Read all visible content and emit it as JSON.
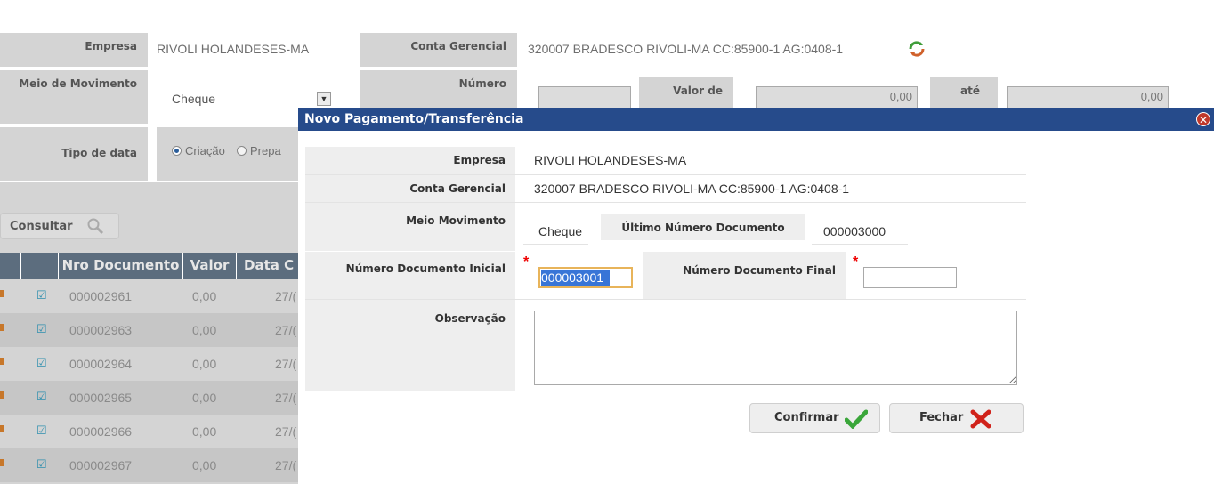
{
  "filters": {
    "empresa_label": "Empresa",
    "empresa_value": "RIVOLI HOLANDESES-MA",
    "conta_label": "Conta Gerencial",
    "conta_value": "320007  BRADESCO RIVOLI-MA CC:85900-1 AG:0408-1",
    "meio_label": "Meio de Movimento",
    "meio_value": "Cheque",
    "numero_label": "Número",
    "valor_de_label": "Valor de",
    "valor_de_value": "0,00",
    "ate_label": "até",
    "ate_value": "0,00",
    "tipo_data_label": "Tipo de data",
    "tipo_data_option1": "Criação",
    "tipo_data_option2": "Prepa"
  },
  "consultar_label": "Consultar",
  "grid": {
    "headers": [
      "Nro Documento",
      "Valor",
      "Data C"
    ],
    "rows": [
      {
        "doc": "000002961",
        "valor": "0,00",
        "data": "27/("
      },
      {
        "doc": "000002963",
        "valor": "0,00",
        "data": "27/("
      },
      {
        "doc": "000002964",
        "valor": "0,00",
        "data": "27/("
      },
      {
        "doc": "000002965",
        "valor": "0,00",
        "data": "27/("
      },
      {
        "doc": "000002966",
        "valor": "0,00",
        "data": "27/("
      },
      {
        "doc": "000002967",
        "valor": "0,00",
        "data": "27/("
      }
    ]
  },
  "dialog": {
    "title": "Novo Pagamento/Transferência",
    "empresa_label": "Empresa",
    "empresa_value": "RIVOLI HOLANDESES-MA",
    "conta_label": "Conta Gerencial",
    "conta_value": "320007  BRADESCO RIVOLI-MA CC:85900-1 AG:0408-1",
    "meio_label": "Meio Movimento",
    "meio_value": "Cheque",
    "ultimo_label": "Último Número Documento",
    "ultimo_value": "000003000",
    "inicial_label": "Número Documento Inicial",
    "inicial_value": "000003001",
    "final_label": "Número Documento Final",
    "final_value": "",
    "observacao_label": "Observação",
    "observacao_value": "",
    "confirmar_label": "Confirmar",
    "fechar_label": "Fechar"
  },
  "colors": {
    "title_bar": "#264b8b",
    "grid_header": "#5c6d7e",
    "required": "#ee0000"
  },
  "icons": [
    "refresh-icon",
    "dropdown-arrow-icon",
    "search-icon",
    "close-icon",
    "check-icon",
    "x-icon"
  ]
}
